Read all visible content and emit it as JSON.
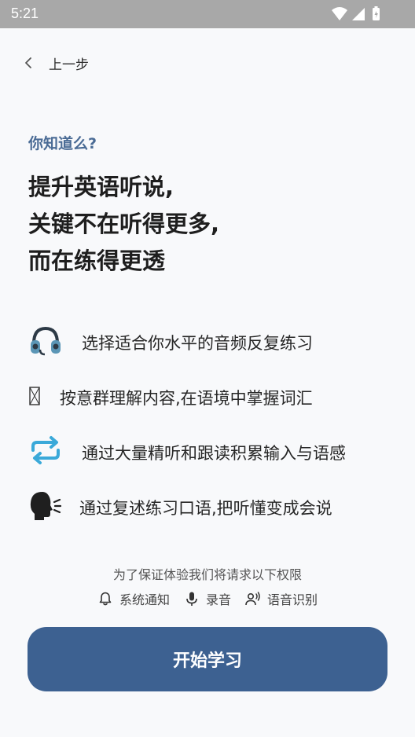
{
  "status_bar": {
    "time": "5:21",
    "icons": [
      "wifi-icon",
      "signal-icon",
      "battery-icon"
    ]
  },
  "nav": {
    "back_label": "上一步"
  },
  "intro": {
    "kicker": "你知道么?",
    "headline": [
      "提升英语听说,",
      "关键不在听得更多,",
      "而在练得更透"
    ]
  },
  "features": [
    {
      "icon": "headphones-icon",
      "text": "选择适合你水平的音频反复练习"
    },
    {
      "icon": "missing-glyph-icon",
      "text": "按意群理解内容,在语境中掌握词汇"
    },
    {
      "icon": "repeat-icon",
      "text": "通过大量精听和跟读积累输入与语感"
    },
    {
      "icon": "speaking-head-icon",
      "text": "通过复述练习口语,把听懂变成会说"
    }
  ],
  "permissions": {
    "notice": "为了保证体验我们将请求以下权限",
    "items": [
      {
        "icon": "bell-icon",
        "label": "系统通知"
      },
      {
        "icon": "microphone-icon",
        "label": "录音"
      },
      {
        "icon": "voice-recognition-icon",
        "label": "语音识别"
      }
    ]
  },
  "cta": {
    "label": "开始学习"
  },
  "colors": {
    "accent": "#3d6191",
    "kicker": "#4a6b95",
    "status_bar": "#a8a8a8",
    "repeat_icon": "#3aa9d9",
    "background": "#f8f9fb"
  }
}
